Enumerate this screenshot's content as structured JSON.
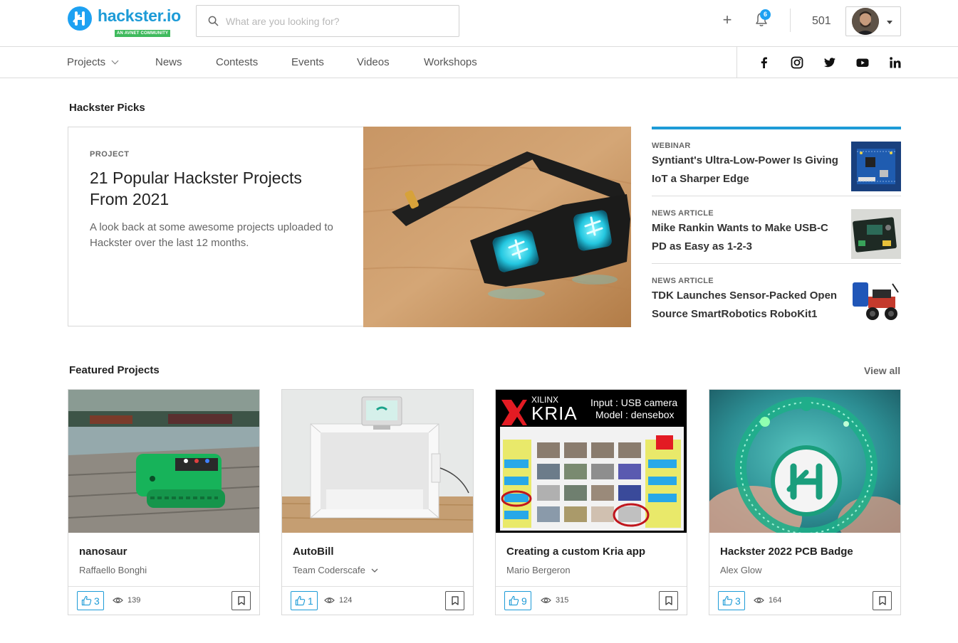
{
  "brand": {
    "name": "hackster.io",
    "tagline": "AN AVNET COMMUNITY",
    "color": "#1d9bd7"
  },
  "search": {
    "placeholder": "What are you looking for?",
    "value": ""
  },
  "header": {
    "notification_count": "6",
    "points": "501"
  },
  "nav": {
    "items": [
      "Projects",
      "News",
      "Contests",
      "Events",
      "Videos",
      "Workshops"
    ],
    "social": [
      "facebook-icon",
      "instagram-icon",
      "twitter-icon",
      "youtube-icon",
      "linkedin-icon"
    ]
  },
  "picks": {
    "title": "Hackster Picks",
    "hero": {
      "type": "PROJECT",
      "title": "21 Popular Hackster Projects From 2021",
      "description": "A look back at some awesome projects uploaded to Hackster over the last 12 months."
    },
    "side": [
      {
        "type": "WEBINAR",
        "title": "Syntiant's Ultra-Low-Power Is Giving IoT a Sharper Edge"
      },
      {
        "type": "NEWS ARTICLE",
        "title": "Mike Rankin Wants to Make USB-C PD as Easy as 1-2-3"
      },
      {
        "type": "NEWS ARTICLE",
        "title": "TDK Launches Sensor-Packed Open Source SmartRobotics RoboKit1"
      }
    ]
  },
  "featured": {
    "title": "Featured Projects",
    "view_all": "View all",
    "kria_text": {
      "brand_top": "XILINX",
      "brand": "KRIA",
      "line1": "Input : USB camera",
      "line2": "Model : densebox"
    },
    "cards": [
      {
        "title": "nanosaur",
        "author": "Raffaello Bonghi",
        "likes": "3",
        "views": "139"
      },
      {
        "title": "AutoBill",
        "author": "Team Coderscafe",
        "likes": "1",
        "views": "124"
      },
      {
        "title": "Creating a custom Kria app",
        "author": "Mario Bergeron",
        "likes": "9",
        "views": "315"
      },
      {
        "title": "Hackster 2022 PCB Badge",
        "author": "Alex Glow",
        "likes": "3",
        "views": "164"
      }
    ]
  }
}
